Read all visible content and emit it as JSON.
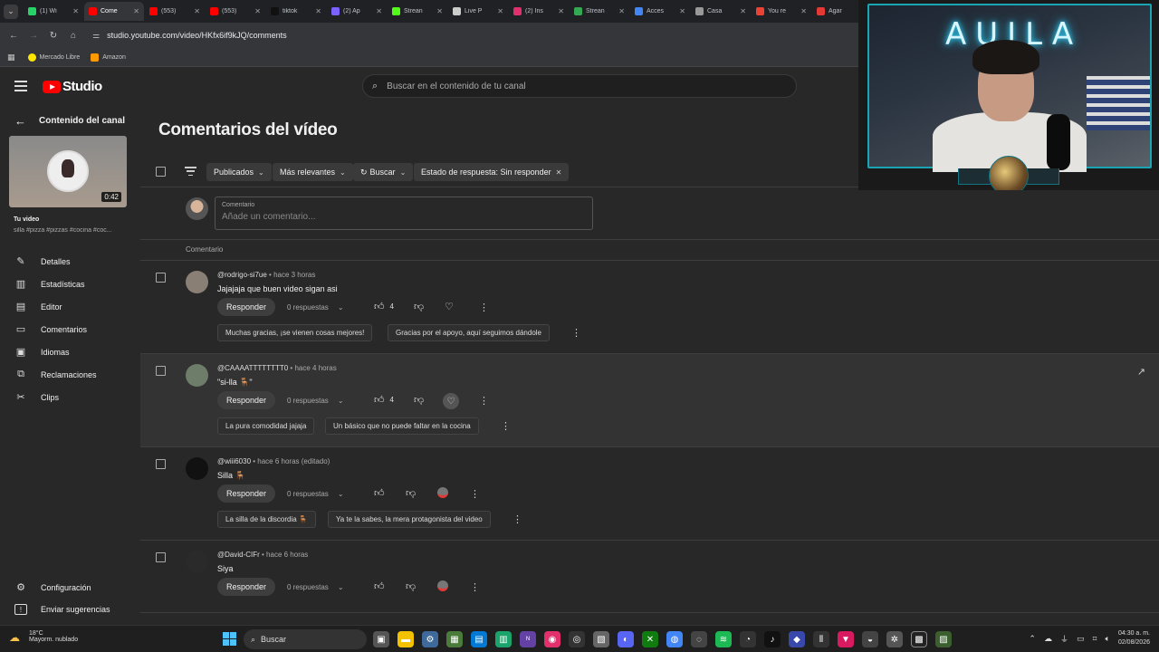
{
  "browser": {
    "tabs": [
      {
        "label": "(1) Wi",
        "color": "#25d366",
        "active": false
      },
      {
        "label": "Come",
        "color": "#ff0000",
        "active": true
      },
      {
        "label": "(553)",
        "color": "#ff0000",
        "active": false
      },
      {
        "label": "(553)",
        "color": "#ff0000",
        "active": false
      },
      {
        "label": "tiktok",
        "color": "#111111",
        "active": false
      },
      {
        "label": "(2) Ap",
        "color": "#7b61ff",
        "active": false
      },
      {
        "label": "Strean",
        "color": "#53fc18",
        "active": false
      },
      {
        "label": "Live P",
        "color": "#cccccc",
        "active": false
      },
      {
        "label": "(2) Ins",
        "color": "#e1306c",
        "active": false
      },
      {
        "label": "Strean",
        "color": "#34a853",
        "active": false
      },
      {
        "label": "Acces",
        "color": "#4285f4",
        "active": false
      },
      {
        "label": "Casa",
        "color": "#999999",
        "active": false
      },
      {
        "label": "You re",
        "color": "#ea4335",
        "active": false
      },
      {
        "label": "Agar",
        "color": "#e53935",
        "active": false
      }
    ],
    "url": "studio.youtube.com/video/HKfx6if9kJQ/comments",
    "bookmarks": [
      {
        "label": "Mercado Libre",
        "color": "#ffe600"
      },
      {
        "label": "Amazon",
        "color": "#ff9900"
      }
    ]
  },
  "header": {
    "logo_text": "Studio",
    "search_placeholder": "Buscar en el contenido de tu canal"
  },
  "sidebar": {
    "back_label": "Contenido del canal",
    "duration": "0:42",
    "video_heading": "Tu video",
    "video_desc": "silla #pizza #pizzas #cocina #coc...",
    "items": [
      {
        "label": "Detalles",
        "icon": "✎"
      },
      {
        "label": "Estadísticas",
        "icon": "▥"
      },
      {
        "label": "Editor",
        "icon": "▤"
      },
      {
        "label": "Comentarios",
        "icon": "▭"
      },
      {
        "label": "Idiomas",
        "icon": "▣"
      },
      {
        "label": "Reclamaciones",
        "icon": "⧉"
      },
      {
        "label": "Clips",
        "icon": "✂"
      }
    ],
    "footer": [
      {
        "label": "Configuración",
        "icon": "⚙"
      },
      {
        "label": "Enviar sugerencias",
        "icon": "!"
      }
    ]
  },
  "main": {
    "title": "Comentarios del vídeo",
    "filters": [
      {
        "label": "Publicados",
        "suffix": "⌄"
      },
      {
        "label": "Más relevantes",
        "suffix": "⌄"
      },
      {
        "label": "Buscar",
        "suffix": "⌄"
      },
      {
        "label": "Estado de respuesta: Sin responder",
        "suffix": "✕"
      }
    ],
    "composer": {
      "label": "Comentario",
      "placeholder": "Añade un comentario..."
    },
    "column_header": "Comentario",
    "reply_label": "Responder",
    "comments": [
      {
        "author": "@rodrigo-si7ue",
        "time": "hace 3 horas",
        "text": "Jajajaja que buen video sigan asi",
        "replies": "0 respuestas",
        "likes": "4",
        "avatar_color": "#8a7f75",
        "suggestions": [
          "Muchas gracias, ¡se vienen cosas mejores!",
          "Gracias por el apoyo, aquí seguimos dándole"
        ]
      },
      {
        "author": "@CAAAATTTTTTTT0",
        "time": "hace 4 horas",
        "text": "\"si-lla 🪑\"",
        "replies": "0 respuestas",
        "likes": "4",
        "avatar_color": "#6e7d6a",
        "suggestions": [
          "La pura comodidad jajaja",
          "Un básico que no puede faltar en la cocina"
        ]
      },
      {
        "author": "@wiii6030",
        "time": "hace 6 horas (editado)",
        "text": "Silla 🪑",
        "replies": "0 respuestas",
        "likes": "",
        "avatar_color": "#111111",
        "suggestions": [
          "La silla de la discordia 🪑",
          "Ya te la sabes, la mera protagonista del video"
        ]
      },
      {
        "author": "@David-CIFr",
        "time": "hace 6 horas",
        "text": "Siya",
        "replies": "0 respuestas",
        "likes": "",
        "avatar_color": "#2a2a2a",
        "suggestions": []
      }
    ]
  },
  "webcam": {
    "neon_text": "AUILA"
  },
  "taskbar": {
    "temperature": "18°C",
    "weather": "Mayorm. nublado",
    "search_label": "Buscar",
    "time": "04:30 a. m.",
    "date": "02/08/2026"
  }
}
